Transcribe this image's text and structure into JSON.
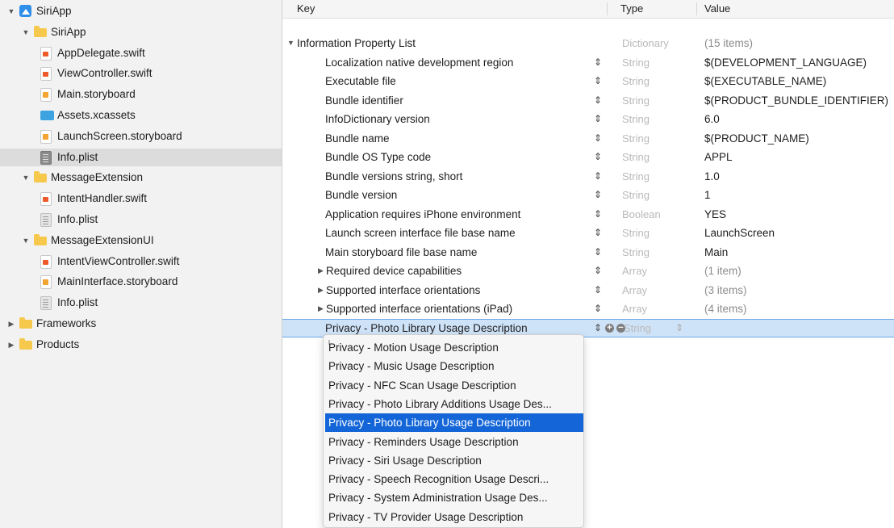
{
  "navigator": {
    "items": [
      {
        "label": "SiriApp",
        "indent": 0,
        "icon": "project-icon",
        "disclosure": "open"
      },
      {
        "label": "SiriApp",
        "indent": 1,
        "icon": "folder-icon",
        "disclosure": "open"
      },
      {
        "label": "AppDelegate.swift",
        "indent": 2,
        "icon": "swift-file-icon",
        "disclosure": "none"
      },
      {
        "label": "ViewController.swift",
        "indent": 2,
        "icon": "swift-file-icon",
        "disclosure": "none"
      },
      {
        "label": "Main.storyboard",
        "indent": 2,
        "icon": "storyboard-icon",
        "disclosure": "none"
      },
      {
        "label": "Assets.xcassets",
        "indent": 2,
        "icon": "assets-icon",
        "disclosure": "none"
      },
      {
        "label": "LaunchScreen.storyboard",
        "indent": 2,
        "icon": "storyboard-icon",
        "disclosure": "none"
      },
      {
        "label": "Info.plist",
        "indent": 2,
        "icon": "plist-icon",
        "disclosure": "none",
        "selected": true
      },
      {
        "label": "MessageExtension",
        "indent": 1,
        "icon": "folder-icon",
        "disclosure": "open"
      },
      {
        "label": "IntentHandler.swift",
        "indent": 2,
        "icon": "swift-file-icon",
        "disclosure": "none"
      },
      {
        "label": "Info.plist",
        "indent": 2,
        "icon": "plist-icon",
        "disclosure": "none"
      },
      {
        "label": "MessageExtensionUI",
        "indent": 1,
        "icon": "folder-icon",
        "disclosure": "open"
      },
      {
        "label": "IntentViewController.swift",
        "indent": 2,
        "icon": "swift-file-icon",
        "disclosure": "none"
      },
      {
        "label": "MainInterface.storyboard",
        "indent": 2,
        "icon": "storyboard-icon",
        "disclosure": "none"
      },
      {
        "label": "Info.plist",
        "indent": 2,
        "icon": "plist-icon",
        "disclosure": "none"
      },
      {
        "label": "Frameworks",
        "indent": 0,
        "icon": "folder-icon",
        "disclosure": "closed"
      },
      {
        "label": "Products",
        "indent": 0,
        "icon": "folder-icon",
        "disclosure": "closed"
      }
    ]
  },
  "editor": {
    "headers": {
      "key": "Key",
      "type": "Type",
      "value": "Value"
    },
    "rows": [
      {
        "key": "Information Property List",
        "type": "Dictionary",
        "value": "(15 items)",
        "level": 0,
        "disclosure": "open",
        "gray_value": true
      },
      {
        "key": "Localization native development region",
        "type": "String",
        "value": "$(DEVELOPMENT_LANGUAGE)",
        "level": 1
      },
      {
        "key": "Executable file",
        "type": "String",
        "value": "$(EXECUTABLE_NAME)",
        "level": 1
      },
      {
        "key": "Bundle identifier",
        "type": "String",
        "value": "$(PRODUCT_BUNDLE_IDENTIFIER)",
        "level": 1
      },
      {
        "key": "InfoDictionary version",
        "type": "String",
        "value": "6.0",
        "level": 1
      },
      {
        "key": "Bundle name",
        "type": "String",
        "value": "$(PRODUCT_NAME)",
        "level": 1
      },
      {
        "key": "Bundle OS Type code",
        "type": "String",
        "value": "APPL",
        "level": 1
      },
      {
        "key": "Bundle versions string, short",
        "type": "String",
        "value": "1.0",
        "level": 1
      },
      {
        "key": "Bundle version",
        "type": "String",
        "value": "1",
        "level": 1
      },
      {
        "key": "Application requires iPhone environment",
        "type": "Boolean",
        "value": "YES",
        "level": 1
      },
      {
        "key": "Launch screen interface file base name",
        "type": "String",
        "value": "LaunchScreen",
        "level": 1
      },
      {
        "key": "Main storyboard file base name",
        "type": "String",
        "value": "Main",
        "level": 1
      },
      {
        "key": "Required device capabilities",
        "type": "Array",
        "value": "(1 item)",
        "level": 1,
        "disclosure": "closed",
        "gray_value": true
      },
      {
        "key": "Supported interface orientations",
        "type": "Array",
        "value": "(3 items)",
        "level": 1,
        "disclosure": "closed",
        "gray_value": true
      },
      {
        "key": "Supported interface orientations (iPad)",
        "type": "Array",
        "value": "(4 items)",
        "level": 1,
        "disclosure": "closed",
        "gray_value": true
      },
      {
        "key": "Privacy - Photo Library Usage Description",
        "type": "String",
        "value": "",
        "level": 1,
        "selected": true
      }
    ]
  },
  "dropdown": {
    "items": [
      "Privacy - Motion Usage Description",
      "Privacy - Music Usage Description",
      "Privacy - NFC Scan Usage Description",
      "Privacy - Photo Library Additions Usage Des...",
      "Privacy - Photo Library Usage Description",
      "Privacy - Reminders Usage Description",
      "Privacy - Siri Usage Description",
      "Privacy - Speech Recognition Usage Descri...",
      "Privacy - System Administration Usage Des...",
      "Privacy - TV Provider Usage Description"
    ],
    "highlighted_index": 4
  },
  "colors": {
    "selection_blue": "#1466d8",
    "row_selection": "#cfe3f8",
    "sidebar_bg": "#f2f2f2"
  }
}
